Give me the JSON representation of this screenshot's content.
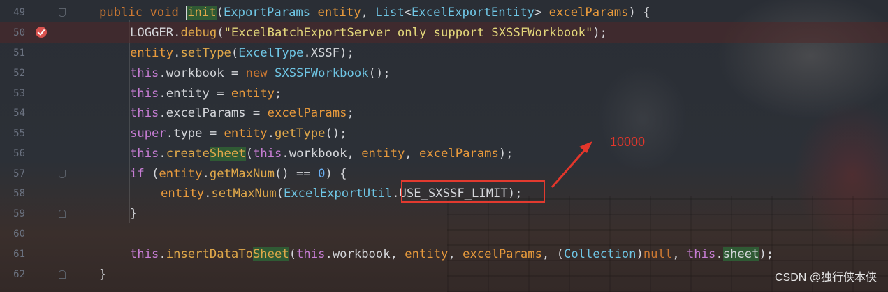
{
  "line_numbers": [
    "49",
    "50",
    "51",
    "52",
    "53",
    "54",
    "55",
    "56",
    "57",
    "58",
    "59",
    "60",
    "61",
    "62"
  ],
  "code": {
    "l49": {
      "a": "public ",
      "b": "void ",
      "c": "i",
      "d": "nit",
      "e": "(",
      "f": "ExportParams ",
      "g": "entity",
      "h": ", ",
      "i": "List",
      "j": "<",
      "k": "ExcelExportEntity",
      "l": "> ",
      "m": "excelParams",
      "n": ") {"
    },
    "l50": {
      "a": "LOGGER",
      "b": ".",
      "c": "debug",
      "d": "(",
      "e": "\"ExcelBatchExportServer only support SXSSFWorkbook\"",
      "f": ");"
    },
    "l51": {
      "a": "entity",
      "b": ".",
      "c": "setType",
      "d": "(",
      "e": "ExcelType",
      "f": ".XSSF",
      "g": ");"
    },
    "l52": {
      "a": "this",
      "b": ".workbook = ",
      "c": "new ",
      "d": "SXSSFWorkbook",
      "e": "();"
    },
    "l53": {
      "a": "this",
      "b": ".entity = ",
      "c": "entity",
      "d": ";"
    },
    "l54": {
      "a": "this",
      "b": ".excelParams = ",
      "c": "excelParams",
      "d": ";"
    },
    "l55": {
      "a": "super",
      "b": ".type = ",
      "c": "entity",
      "d": ".",
      "e": "getType",
      "f": "();"
    },
    "l56": {
      "a": "this",
      "b": ".",
      "c": "create",
      "d": "Sheet",
      "e": "(",
      "f": "this",
      "g": ".workbook, ",
      "h": "entity",
      "i": ", ",
      "j": "excelParams",
      "k": ");"
    },
    "l57": {
      "a": "if ",
      "b": "(",
      "c": "entity",
      "d": ".",
      "e": "getMaxNum",
      "f": "() == ",
      "g": "0",
      "h": ") {"
    },
    "l58": {
      "a": "entity",
      "b": ".",
      "c": "setMaxNum",
      "d": "(",
      "e": "ExcelExportUtil",
      "f": ".",
      "g": "USE_SXSSF_LIMIT",
      "h": ");"
    },
    "l59": {
      "a": "}"
    },
    "l61": {
      "a": "this",
      "b": ".",
      "c": "insertDataTo",
      "d": "Sheet",
      "e": "(",
      "f": "this",
      "g": ".workbook, ",
      "h": "entity",
      "i": ", ",
      "j": "excelParams",
      "k": ", (",
      "l": "Collection",
      "m": ")",
      "n": "null",
      "o": ", ",
      "p": "this",
      "q": ".",
      "r": "sheet",
      "s": ");"
    },
    "l62": {
      "a": "}"
    }
  },
  "annotation": {
    "text": "10000",
    "color": "#e3362b"
  },
  "watermark": "CSDN @独行侠本侠",
  "colors": {
    "background": "#2b2f36",
    "keyword": "#cc7832",
    "string": "#e2d67a",
    "breakpoint": "#d9534f"
  }
}
